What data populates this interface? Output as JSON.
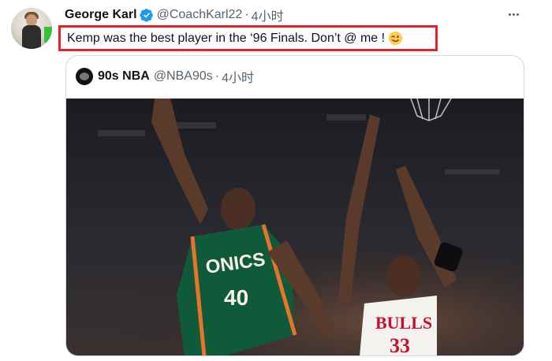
{
  "author": {
    "name": "George Karl",
    "handle": "@CoachKarl22",
    "separator": "·",
    "time": "4小时"
  },
  "tweet": {
    "text": "Kemp was the best player in the ‘96 Finals. Don’t @ me !",
    "emoji": "winking-face"
  },
  "quoted": {
    "name": "90s NBA",
    "handle": "@NBA90s",
    "separator": "·",
    "time": "4小时",
    "image": {
      "description_icon": "basketball-photo",
      "jersey_left_text": "ONICS",
      "jersey_left_number": "40",
      "jersey_right_text": "BULLS",
      "jersey_right_number": "33"
    }
  },
  "colors": {
    "highlight_border": "#e6202a",
    "verified": "#1d9bf0",
    "muted_text": "#536471",
    "sonics_green": "#0f5a3a",
    "sonics_orange": "#e8742a",
    "bulls_red": "#c8102e"
  }
}
